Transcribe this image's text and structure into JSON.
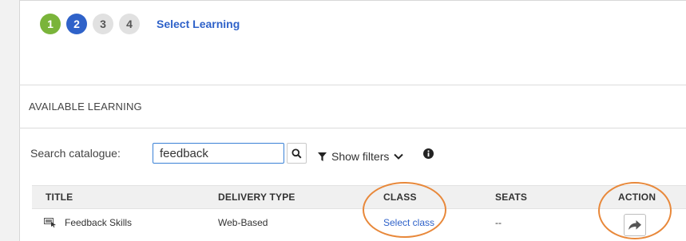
{
  "wizard": {
    "steps": [
      {
        "number": "1",
        "state": "complete"
      },
      {
        "number": "2",
        "state": "current"
      },
      {
        "number": "3",
        "state": "pending"
      },
      {
        "number": "4",
        "state": "pending"
      }
    ],
    "current_step_label": "Select Learning"
  },
  "section": {
    "title": "AVAILABLE LEARNING"
  },
  "search": {
    "label": "Search catalogue:",
    "value": "feedback",
    "button_icon": "search-icon"
  },
  "filters": {
    "label": "Show filters",
    "icon": "filter-funnel-icon",
    "toggle_icon": "chevron-down-icon",
    "info_icon": "info-circle-icon"
  },
  "table": {
    "columns": [
      "TITLE",
      "DELIVERY TYPE",
      "CLASS",
      "SEATS",
      "ACTION"
    ],
    "rows": [
      {
        "icon": "computer-course-icon",
        "title": "Feedback Skills",
        "delivery_type": "Web-Based",
        "class": "Select class",
        "seats": "--",
        "action_icon": "share-arrow-icon"
      }
    ]
  },
  "colors": {
    "step_complete": "#7ab43a",
    "step_current": "#2f62c9",
    "step_pending": "#e1e1e1",
    "link": "#2f62c9",
    "annotation_circle": "#e8883a"
  }
}
